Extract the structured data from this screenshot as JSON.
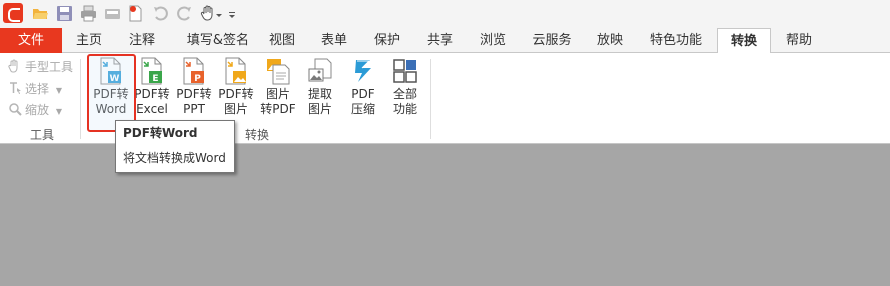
{
  "quick_access": {
    "icons": [
      "app-logo-icon",
      "open-folder-icon",
      "save-icon",
      "print-icon",
      "scan-icon",
      "new-doc-icon",
      "undo-icon",
      "redo-icon",
      "hand-tool-icon",
      "customize-icon"
    ]
  },
  "menu": {
    "items": [
      {
        "label": "文件",
        "state": "file"
      },
      {
        "label": "主页"
      },
      {
        "label": "注释"
      },
      {
        "label": "填写&签名"
      },
      {
        "label": "视图"
      },
      {
        "label": "表单"
      },
      {
        "label": "保护"
      },
      {
        "label": "共享"
      },
      {
        "label": "浏览"
      },
      {
        "label": "云服务"
      },
      {
        "label": "放映"
      },
      {
        "label": "特色功能"
      },
      {
        "label": "转换",
        "state": "active"
      },
      {
        "label": "帮助"
      }
    ]
  },
  "ribbon": {
    "tools_group": {
      "hand": "手型工具",
      "select": "选择",
      "zoom": "缩放",
      "label": "工具"
    },
    "convert_group": {
      "label": "转换",
      "buttons": [
        {
          "line1": "PDF转",
          "line2": "Word",
          "color": "#2b9bd6"
        },
        {
          "line1": "PDF转",
          "line2": "Excel",
          "color": "#3aa64a"
        },
        {
          "line1": "PDF转",
          "line2": "PPT",
          "color": "#e8622c"
        },
        {
          "line1": "PDF转",
          "line2": "图片",
          "color": "#f0a81b"
        },
        {
          "line1": "图片",
          "line2": "转PDF",
          "color": "#f0a81b"
        },
        {
          "line1": "提取",
          "line2": "图片",
          "color": "#7a7a7a"
        },
        {
          "line1": "PDF",
          "line2": "压缩",
          "color": "#2b9bd6"
        },
        {
          "line1": "全部",
          "line2": "功能",
          "color": "#3b6fb6"
        }
      ]
    }
  },
  "tooltip": {
    "title": "PDF转Word",
    "description": "将文档转换成Word"
  }
}
